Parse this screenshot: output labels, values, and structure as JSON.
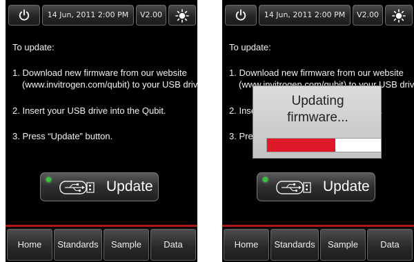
{
  "colors": {
    "accent_red": "#e0192a",
    "nav_divider": "#b01818",
    "led_green": "#35c43a",
    "screen_bg": "#000000"
  },
  "screens": [
    {
      "topbar": {
        "power_icon": "power-icon",
        "datetime": "14 Jun, 2011   2:00 PM",
        "version": "V2.00",
        "brightness_icon": "brightness-icon"
      },
      "instructions": {
        "heading": "To update:",
        "step1_line1": "1. Download new firmware from our website",
        "step1_line2": "(www.invitrogen.com/qubit) to your USB drive.",
        "step2": "2. Insert your USB drive into the Qubit.",
        "step3": "3. Press “Update” button."
      },
      "update_button": {
        "label": "Update",
        "usb_icon": "usb-drive-icon"
      },
      "nav": {
        "home": "Home",
        "standards": "Standards",
        "sample": "Sample",
        "data": "Data"
      }
    },
    {
      "topbar": {
        "power_icon": "power-icon",
        "datetime": "14 Jun, 2011   2:00 PM",
        "version": "V2.00",
        "brightness_icon": "brightness-icon"
      },
      "instructions": {
        "heading": "To update:",
        "step1_line1": "1. Download new firmware from our website",
        "step1_line2": "(www.invitrogen.com/qubit) to your USB drive.",
        "step2": "2. Insert your USB drive into the Qubit.",
        "step3": "3. Press “Update” button."
      },
      "update_button": {
        "label": "Update",
        "usb_icon": "usb-drive-icon"
      },
      "nav": {
        "home": "Home",
        "standards": "Standards",
        "sample": "Sample",
        "data": "Data"
      },
      "modal": {
        "title": "Updating\nfirmware...",
        "progress": 0.6
      }
    }
  ]
}
